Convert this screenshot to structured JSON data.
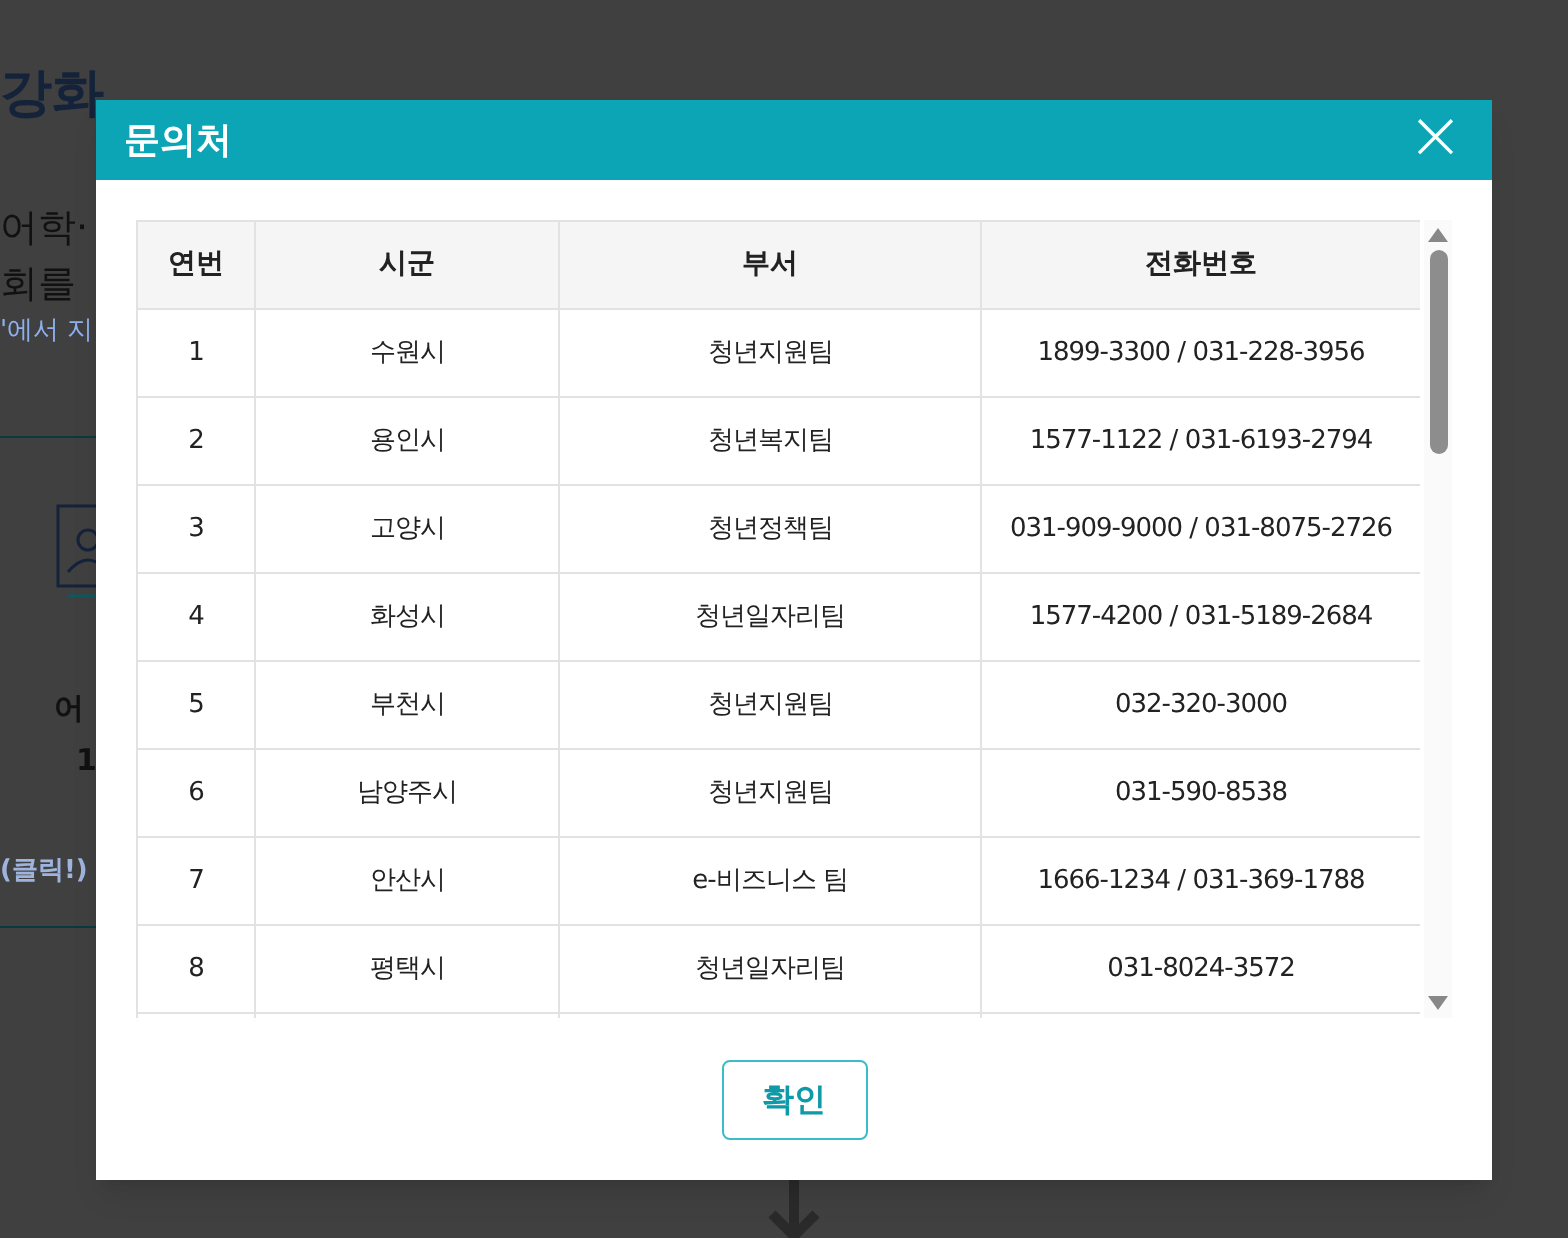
{
  "background": {
    "title": "강화",
    "lines": [
      "어학·",
      "회를",
      "'에서 지"
    ],
    "card_title": "어",
    "card_value": "1",
    "card_link": "(클릭!)"
  },
  "dialog": {
    "title": "문의처",
    "close": "×",
    "table": {
      "columns": [
        "연번",
        "시군",
        "부서",
        "전화번호"
      ],
      "rows": [
        [
          "1",
          "수원시",
          "청년지원팀",
          "1899-3300 / 031-228-3956"
        ],
        [
          "2",
          "용인시",
          "청년복지팀",
          "1577-1122 / 031-6193-2794"
        ],
        [
          "3",
          "고양시",
          "청년정책팀",
          "031-909-9000 / 031-8075-2726"
        ],
        [
          "4",
          "화성시",
          "청년일자리팀",
          "1577-4200 / 031-5189-2684"
        ],
        [
          "5",
          "부천시",
          "청년지원팀",
          "032-320-3000"
        ],
        [
          "6",
          "남양주시",
          "청년지원팀",
          "031-590-8538"
        ],
        [
          "7",
          "안산시",
          "e-비즈니스 팀",
          "1666-1234 / 031-369-1788"
        ],
        [
          "8",
          "평택시",
          "청년일자리팀",
          "031-8024-3572"
        ]
      ]
    },
    "button": "확인"
  }
}
